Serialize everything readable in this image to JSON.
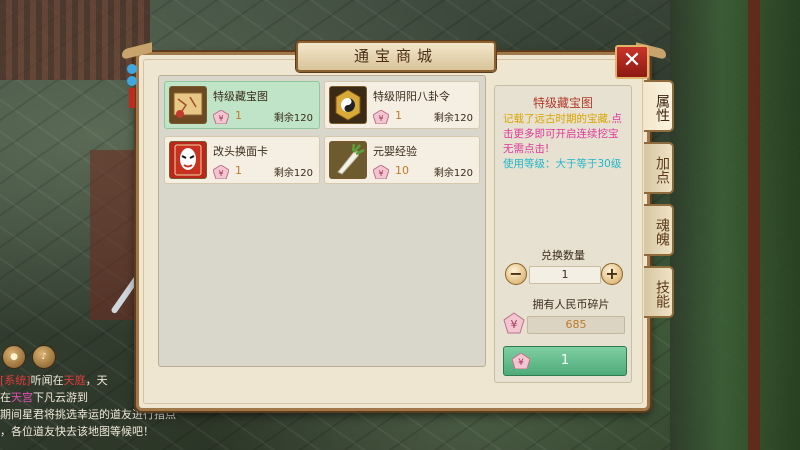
{
  "dialog": {
    "title": "通宝商城",
    "close_label": "✕"
  },
  "side_tabs": [
    {
      "label": "属性"
    },
    {
      "label": "加点"
    },
    {
      "label": "魂魄"
    },
    {
      "label": "技能"
    }
  ],
  "items": [
    {
      "name": "特级藏宝图",
      "price": "1",
      "stock": "剩余120",
      "icon": "treasure-map-icon",
      "selected": true
    },
    {
      "name": "特级阴阳八卦令",
      "price": "1",
      "stock": "剩余120",
      "icon": "yin-yang-token-icon",
      "selected": false
    },
    {
      "name": "改头换面卡",
      "price": "1",
      "stock": "剩余120",
      "icon": "opera-mask-card-icon",
      "selected": false
    },
    {
      "name": "元婴经验",
      "price": "10",
      "stock": "剩余120",
      "icon": "radish-icon",
      "selected": false
    }
  ],
  "detail": {
    "title": "特级藏宝图",
    "desc_yellow": "记载了远古时期的宝藏,",
    "desc_magenta": "点击更多即可开启连续挖宝无需点击!",
    "desc_cyan": "使用等级：大于等于30级",
    "qty_label": "兑换数量",
    "qty_value": "1",
    "minus_label": "−",
    "plus_label": "+",
    "owned_label": "拥有人民币碎片",
    "owned_value": "685",
    "buy_label": "1"
  },
  "chat": {
    "line1_tag": "[系统]",
    "line1_a": "听闻在",
    "line1_b": "天庭",
    "line1_c": "，天",
    "line2_a": "在",
    "line2_b": "天宫",
    "line2_c": "下凡云游到",
    "line3": "期间星君将挑选幸运的道友进行指点",
    "line4": "，各位道友快去该地图等候吧！"
  },
  "colors": {
    "accent_red": "#b23a2a",
    "selected_green": "#bfe4c7",
    "buy_green": "#4fab7a",
    "price_orange": "#c07a2a"
  }
}
